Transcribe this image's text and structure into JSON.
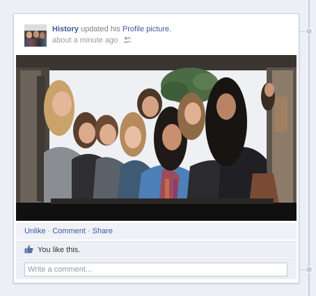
{
  "post": {
    "author": "History",
    "action_text": "updated his",
    "link_text": "Profile picture.",
    "timestamp": "about a minute ago",
    "privacy_icon": "friends-icon"
  },
  "actions": {
    "unlike": "Unlike",
    "separator": "·",
    "comment": "Comment",
    "share": "Share"
  },
  "likes": {
    "icon": "thumbs-up-icon",
    "text": "You like this."
  },
  "comment_box": {
    "placeholder": "Write a comment..."
  },
  "colors": {
    "link": "#3b5998",
    "muted": "#999999",
    "card_border": "#c4cde0",
    "actions_bg": "#f0f2f7"
  }
}
